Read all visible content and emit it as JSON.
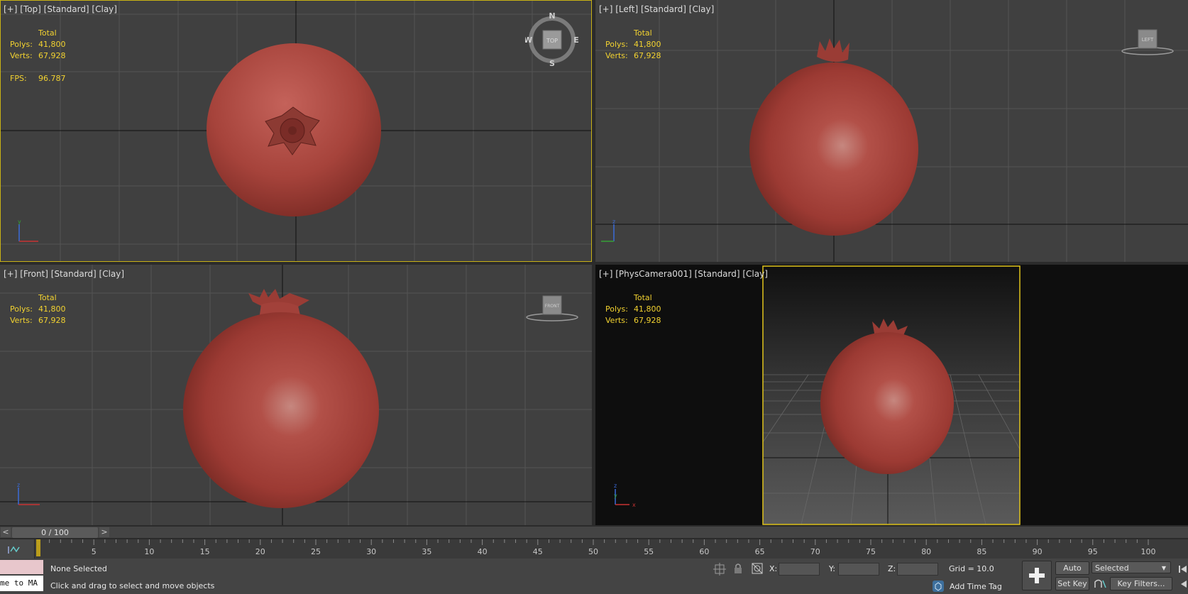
{
  "viewports": {
    "top": {
      "label": "[+] [Top] [Standard] [Clay]",
      "cube_label": "TOP",
      "compass": {
        "n": "N",
        "s": "S",
        "e": "E",
        "w": "W"
      }
    },
    "left": {
      "label": "[+] [Left] [Standard] [Clay]",
      "cube_label": "LEFT"
    },
    "front": {
      "label": "[+] [Front] [Standard] [Clay]",
      "cube_label": "FRONT"
    },
    "camera": {
      "label": "[+] [PhysCamera001] [Standard] [Clay]"
    }
  },
  "stats": {
    "total_label": "Total",
    "polys_label": "Polys:",
    "polys_value": "41,800",
    "verts_label": "Verts:",
    "verts_value": "67,928",
    "fps_label": "FPS:",
    "fps_value": "96.787"
  },
  "axis": {
    "x": "x",
    "y": "y",
    "z": "z"
  },
  "timeline": {
    "frame_display": "0 / 100",
    "prev_label": "<",
    "next_label": ">",
    "current_frame": 0,
    "total_frames": 100,
    "tick_labels": [
      "5",
      "10",
      "15",
      "20",
      "25",
      "30",
      "35",
      "40",
      "45",
      "50",
      "55",
      "60",
      "65",
      "70",
      "75",
      "80",
      "85",
      "90",
      "95",
      "100"
    ]
  },
  "status": {
    "selection": "None Selected",
    "prompt": "Click and drag to select and move objects",
    "maxscript_text": "me to MA",
    "x_label": "X:",
    "y_label": "Y:",
    "z_label": "Z:",
    "grid": "Grid = 10.0",
    "add_time_tag": "Add Time Tag",
    "auto_key": "Auto Key",
    "set_key": "Set Key",
    "selected": "Selected",
    "key_filters": "Key Filters..."
  },
  "colors": {
    "viewport_bg": "#404040",
    "grid_line": "#525252",
    "axis_line": "#0a0a0a",
    "stats_yellow": "#f2d230",
    "active_border": "#c9b215",
    "pomegranate": "#a8413a"
  }
}
